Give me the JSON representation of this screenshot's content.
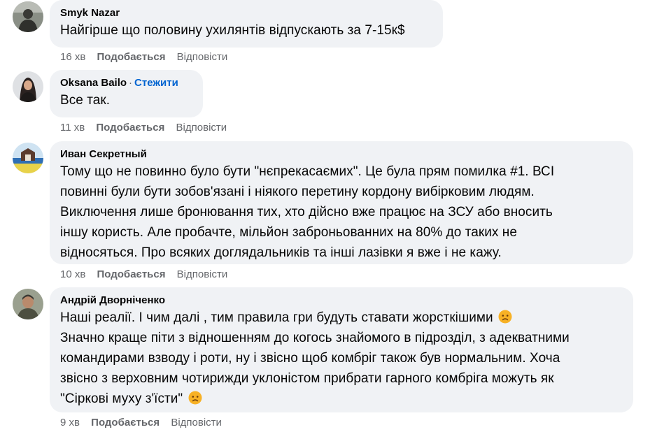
{
  "comments": [
    {
      "author": "Smyk Nazar",
      "follow": "",
      "text": "Найгірше що половину ухилянтів відпускають за 7-15к$",
      "time": "16 хв",
      "like": "Подобається",
      "reply": "Відповісти"
    },
    {
      "author": "Oksana Bailo",
      "separator": "·",
      "follow": "Стежити",
      "text": "Все так.",
      "time": "11 хв",
      "like": "Подобається",
      "reply": "Відповісти"
    },
    {
      "author": "Иван Секретный",
      "follow": "",
      "text": "Тому що не повинно було бути \"нєпрекасаємих\". Це була прям помилка #1. ВСІ\nповинні були бути зобов'язані і ніякого перетину кордону вибірковим людям.\nВиключення лише бронювання тих, хто дійсно вже працює на ЗСУ або вносить\nіншу користь. Але пробачте, мільйон заброньованних на 80% до таких не\nвідносяться. Про всяких доглядальників та інші лазівки я вже і не кажу.",
      "time": "10 хв",
      "like": "Подобається",
      "reply": "Відповісти"
    },
    {
      "author": "Андрій Дворніченко",
      "follow": "",
      "line1": "Наші реалії. І чим далі , тим правила гри будуть ставати жорсткішими",
      "text": "Значно краще піти з відношенням до когось знайомого в підрозділ, з адекватними\nкомандирами взводу і роти, ну і звісно щоб комбріг також був нормальним. Хоча\nзвісно з верховним чотирижди уклоністом прибрати гарного комбріга можуть як",
      "line_last": "\"Сіркові муху з'їсти\"",
      "emoji": "sad-face-emoji",
      "time": "9 хв",
      "like": "Подобається",
      "reply": "Відповісти"
    }
  ],
  "colors": {
    "bubble": "#f0f2f5",
    "meta": "#65676b",
    "link": "#0064d1",
    "emoji": "#f7b125"
  }
}
